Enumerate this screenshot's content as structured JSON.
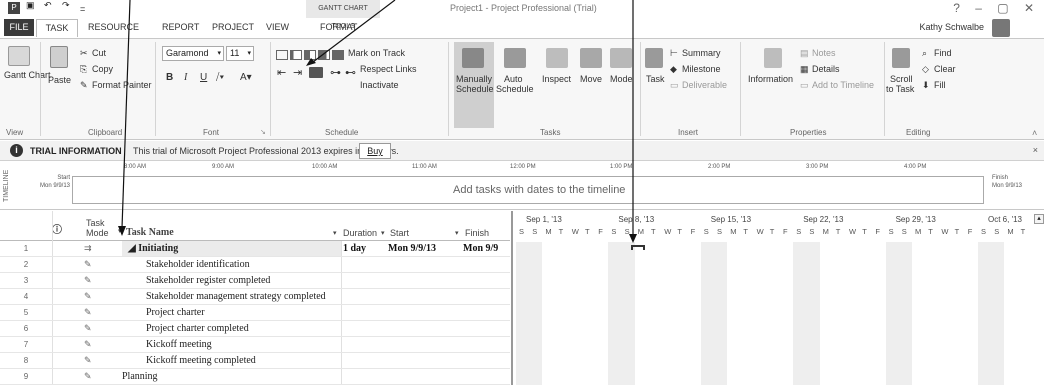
{
  "titlebar": {
    "quick_access": [
      "P",
      "💾",
      "↶",
      "↷",
      "="
    ],
    "gantt_tools": "GANTT CHART TOOLS",
    "app_title": "Project1 - Project Professional (Trial)",
    "window_controls": "? – ▢ ✕"
  },
  "tabs": {
    "file": "FILE",
    "task": "TASK",
    "resource": "RESOURCE",
    "report": "REPORT",
    "project": "PROJECT",
    "view": "VIEW",
    "format": "FORMAT",
    "user": "Kathy Schwalbe"
  },
  "ribbon": {
    "view": {
      "gantt_label": "Gantt Chart",
      "group": "View"
    },
    "clipboard": {
      "paste": "Paste",
      "cut": "Cut",
      "copy": "Copy",
      "format_painter": "Format Painter",
      "group": "Clipboard"
    },
    "font": {
      "font_name": "Garamond",
      "font_size": "11",
      "bold": "B",
      "italic": "I",
      "underline": "U",
      "group": "Font"
    },
    "schedule": {
      "mark_on_track": "Mark on Track",
      "respect_links": "Respect Links",
      "inactivate": "Inactivate",
      "group": "Schedule"
    },
    "tasks": {
      "manually": "Manually",
      "schedule1": "Schedule",
      "auto": "Auto",
      "schedule2": "Schedule",
      "inspect": "Inspect",
      "move": "Move",
      "mode": "Mode",
      "group": "Tasks"
    },
    "insert": {
      "task": "Task",
      "summary": "Summary",
      "milestone": "Milestone",
      "deliverable": "Deliverable",
      "group": "Insert"
    },
    "properties": {
      "information": "Information",
      "notes": "Notes",
      "details": "Details",
      "add_to_timeline": "Add to Timeline",
      "group": "Properties"
    },
    "editing": {
      "scroll": "Scroll",
      "to_task": "to Task",
      "find": "Find",
      "clear": "Clear",
      "fill": "Fill",
      "group": "Editing"
    }
  },
  "infobar": {
    "title": "TRIAL INFORMATION",
    "message": "This trial of Microsoft Project Professional 2013 expires in 50 days.",
    "buy": "Buy",
    "close": "×"
  },
  "timeline": {
    "label": "TIMELINE",
    "start_label": "Start",
    "start_date": "Mon 9/9/13",
    "finish_label": "Finish",
    "finish_date": "Mon 9/9/13",
    "ticks": [
      "8:00 AM",
      "9:00 AM",
      "10:00 AM",
      "11:00 AM",
      "12:00 PM",
      "1:00 PM",
      "2:00 PM",
      "3:00 PM",
      "4:00 PM"
    ],
    "message": "Add tasks with dates to the timeline"
  },
  "grid": {
    "headers": {
      "info": "ⓘ",
      "mode": "Task Mode",
      "name": "Task Name",
      "duration": "Duration",
      "start": "Start",
      "finish": "Finish"
    },
    "rows": [
      {
        "n": "1",
        "name": "◢ Initiating",
        "summary": true,
        "duration": "1 day",
        "start": "Mon 9/9/13",
        "finish": "Mon 9/9"
      },
      {
        "n": "2",
        "name": "Stakeholder identification"
      },
      {
        "n": "3",
        "name": "Stakeholder register completed"
      },
      {
        "n": "4",
        "name": "Stakeholder management strategy completed"
      },
      {
        "n": "5",
        "name": "Project charter"
      },
      {
        "n": "6",
        "name": "Project charter completed"
      },
      {
        "n": "7",
        "name": "Kickoff meeting"
      },
      {
        "n": "8",
        "name": "Kickoff meeting completed"
      },
      {
        "n": "9",
        "name": "Planning",
        "level0": true
      }
    ]
  },
  "gantt": {
    "weeks": [
      "Sep 1, '13",
      "Sep 8, '13",
      "Sep 15, '13",
      "Sep 22, '13",
      "Sep 29, '13",
      "Oct 6, '13"
    ],
    "days": [
      "S",
      "S",
      "M",
      "T",
      "W",
      "T",
      "F"
    ]
  }
}
